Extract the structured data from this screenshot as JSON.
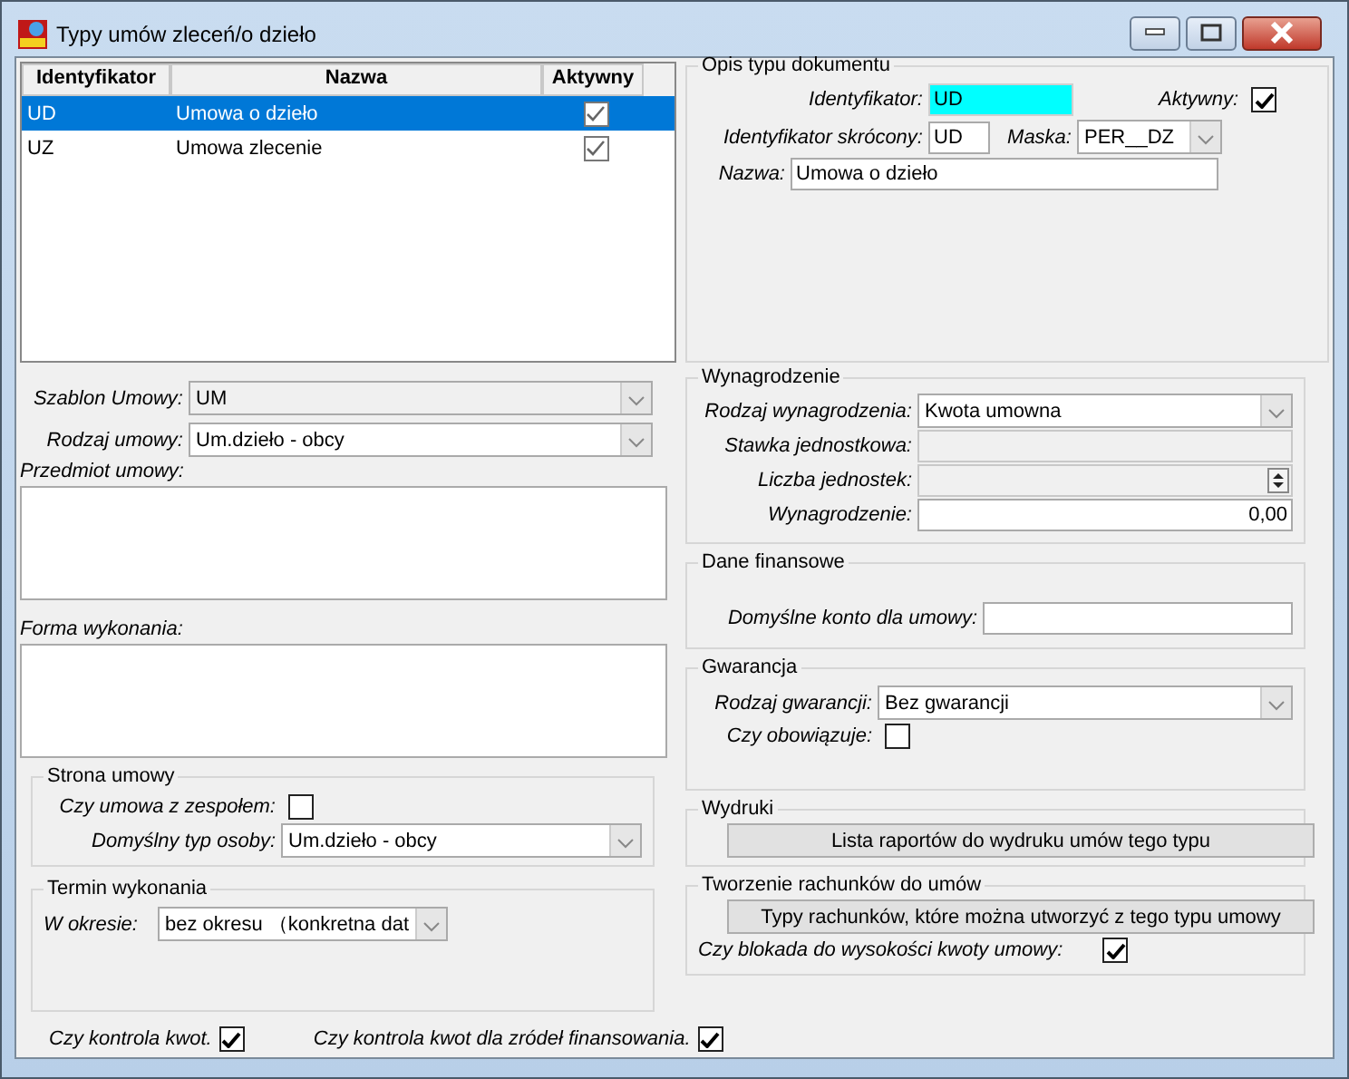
{
  "window": {
    "title": "Typy umów zleceń/o dzieło"
  },
  "table": {
    "columns": [
      "Identyfikator",
      "Nazwa",
      "Aktywny"
    ],
    "rows": [
      {
        "id": "UD",
        "name": "Umowa o dzieło",
        "active": true,
        "selected": true
      },
      {
        "id": "UZ",
        "name": "Umowa zlecenie",
        "active": true,
        "selected": false
      }
    ]
  },
  "document": {
    "title": "Opis typu dokumentu",
    "id_label": "Identyfikator:",
    "id_value": "UD",
    "active_label": "Aktywny:",
    "active": true,
    "short_label": "Identyfikator skrócony:",
    "short_value": "UD",
    "mask_label": "Maska:",
    "mask_value": "PER__DZ",
    "name_label": "Nazwa:",
    "name_value": "Umowa o dzieło"
  },
  "contract": {
    "template_label": "Szablon Umowy:",
    "template_value": "UM",
    "template_disabled": true,
    "kind_label": "Rodzaj umowy:",
    "kind_value": "Um.dzieło - obcy",
    "subject_label": "Przedmiot umowy:",
    "form_label": "Forma wykonania:"
  },
  "party": {
    "title": "Strona umowy",
    "team_label": "Czy umowa z zespołem:",
    "team": false,
    "person_label": "Domyślny typ osoby:",
    "person_value": "Um.dzieło - obcy"
  },
  "term": {
    "title": "Termin wykonania",
    "period_label": "W okresie:",
    "period_value": "bez okresu （konkretna dat"
  },
  "pay": {
    "title": "Wynagrodzenie",
    "rows": [
      {
        "kind": "select",
        "label": "Rodzaj wynagrodzenia:",
        "value": "Kwota umowna",
        "disabled": false
      },
      {
        "kind": "text",
        "label": "Stawka jednostkowa:",
        "disabled": true
      },
      {
        "kind": "spin",
        "label": "Liczba jednostek:",
        "disabled": true
      },
      {
        "kind": "number",
        "label": "Wynagrodzenie:",
        "value": "0,00",
        "disabled": false
      }
    ]
  },
  "finance": {
    "title": "Dane finansowe",
    "account_label": "Domyślne konto dla umowy:"
  },
  "guarantee": {
    "title": "Gwarancja",
    "kind_label": "Rodzaj gwarancji:",
    "kind_value": "Bez gwarancji",
    "binding_label": "Czy obowiązuje:",
    "binding": false
  },
  "prints": {
    "title": "Wydruki",
    "button": "Lista raportów do wydruku umów tego typu"
  },
  "bills": {
    "title": "Tworzenie rachunków do umów",
    "button": "Typy rachunków, które można utworzyć z tego typu umowy",
    "block_label": "Czy blokada do wysokości kwoty umowy:",
    "block": true
  },
  "footer": [
    {
      "label": "Czy kontrola kwot.",
      "checked": true
    },
    {
      "label": "Czy kontrola kwot dla zródeł finansowania.",
      "checked": true
    }
  ]
}
